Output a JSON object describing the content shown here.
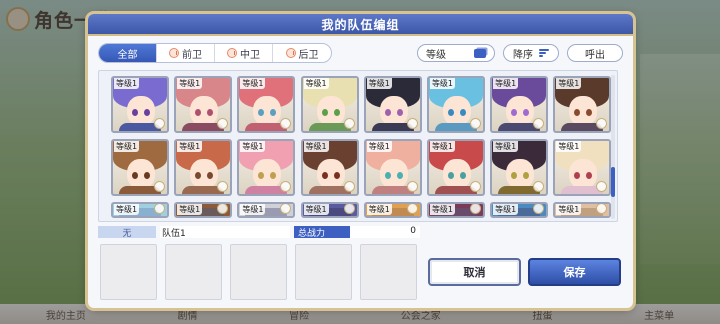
{
  "background": {
    "title": "角色一览",
    "nav": [
      "我的主页",
      "剧情",
      "冒险",
      "公会之家",
      "扭蛋",
      "主菜单"
    ]
  },
  "modal": {
    "title": "我的队伍编组",
    "tabs": [
      "全部",
      "前卫",
      "中卫",
      "后卫"
    ],
    "level_label": "等级",
    "sort_label": "降序",
    "call_label": "呼出"
  },
  "cards": [
    {
      "level": "等级1",
      "hair": "#7a6bd0",
      "eye": "#6b3fa0",
      "body": "#4b5aa0"
    },
    {
      "level": "等级1",
      "hair": "#d9868a",
      "eye": "#b05070",
      "body": "#8a4b60"
    },
    {
      "level": "等级1",
      "hair": "#e0707a",
      "eye": "#5aa0c0",
      "body": "#c06070"
    },
    {
      "level": "等级1",
      "hair": "#e8e0b0",
      "eye": "#5aa04a",
      "body": "#6a9a55"
    },
    {
      "level": "等级1",
      "hair": "#2a2a38",
      "eye": "#a060b0",
      "body": "#3a3a55"
    },
    {
      "level": "等级1",
      "hair": "#6ac0e0",
      "eye": "#3a8ac0",
      "body": "#5a9ac0"
    },
    {
      "level": "等级1",
      "hair": "#6a4a9a",
      "eye": "#a06ad0",
      "body": "#4a4a70"
    },
    {
      "level": "等级1",
      "hair": "#5a3a2a",
      "eye": "#8a4a30",
      "body": "#5a4a60"
    },
    {
      "level": "等级1",
      "hair": "#a06a40",
      "eye": "#6a3a20",
      "body": "#8a5a3a"
    },
    {
      "level": "等级1",
      "hair": "#c86a4a",
      "eye": "#7a4a30",
      "body": "#9a6a50"
    },
    {
      "level": "等级1",
      "hair": "#f0a0b0",
      "eye": "#c0a050",
      "body": "#d080a0"
    },
    {
      "level": "等级1",
      "hair": "#6a4030",
      "eye": "#7a3020",
      "body": "#a07060"
    },
    {
      "level": "等级1",
      "hair": "#f0b0a0",
      "eye": "#4ab0b0",
      "body": "#c08080"
    },
    {
      "level": "等级1",
      "hair": "#c84a4a",
      "eye": "#4aa0a0",
      "body": "#a05050"
    },
    {
      "level": "等级1",
      "hair": "#3a2a3a",
      "eye": "#b0a040",
      "body": "#806a30"
    },
    {
      "level": "等级1",
      "hair": "#f0e0c0",
      "eye": "#b04050",
      "body": "#e0c0d0"
    },
    {
      "level": "等级1",
      "hair": "#a0d0e0",
      "eye": "#4a80b0",
      "body": "#8ab0d0"
    },
    {
      "level": "等级1",
      "hair": "#8a5a3a",
      "eye": "#5a3a2a",
      "body": "#6a5a5a"
    },
    {
      "level": "等级1",
      "hair": "#d0d0d8",
      "eye": "#6a6a9a",
      "body": "#9a9ab0"
    },
    {
      "level": "等级1",
      "hair": "#5a5aa0",
      "eye": "#3a3a7a",
      "body": "#4a4a80"
    },
    {
      "level": "等级1",
      "hair": "#e0a050",
      "eye": "#8a5a20",
      "body": "#c08a50"
    },
    {
      "level": "等级1",
      "hair": "#7a3a5a",
      "eye": "#a04a6a",
      "body": "#6a4a6a"
    },
    {
      "level": "等级1",
      "hair": "#4a8ac0",
      "eye": "#2a5a8a",
      "body": "#4a6a9a"
    },
    {
      "level": "等级1",
      "hair": "#e0c0a0",
      "eye": "#a06040",
      "body": "#c0a080"
    }
  ],
  "team": {
    "leader_label": "无",
    "name": "队伍1",
    "power_label": "总战力",
    "power_value": "0"
  },
  "buttons": {
    "cancel": "取消",
    "save": "保存"
  }
}
